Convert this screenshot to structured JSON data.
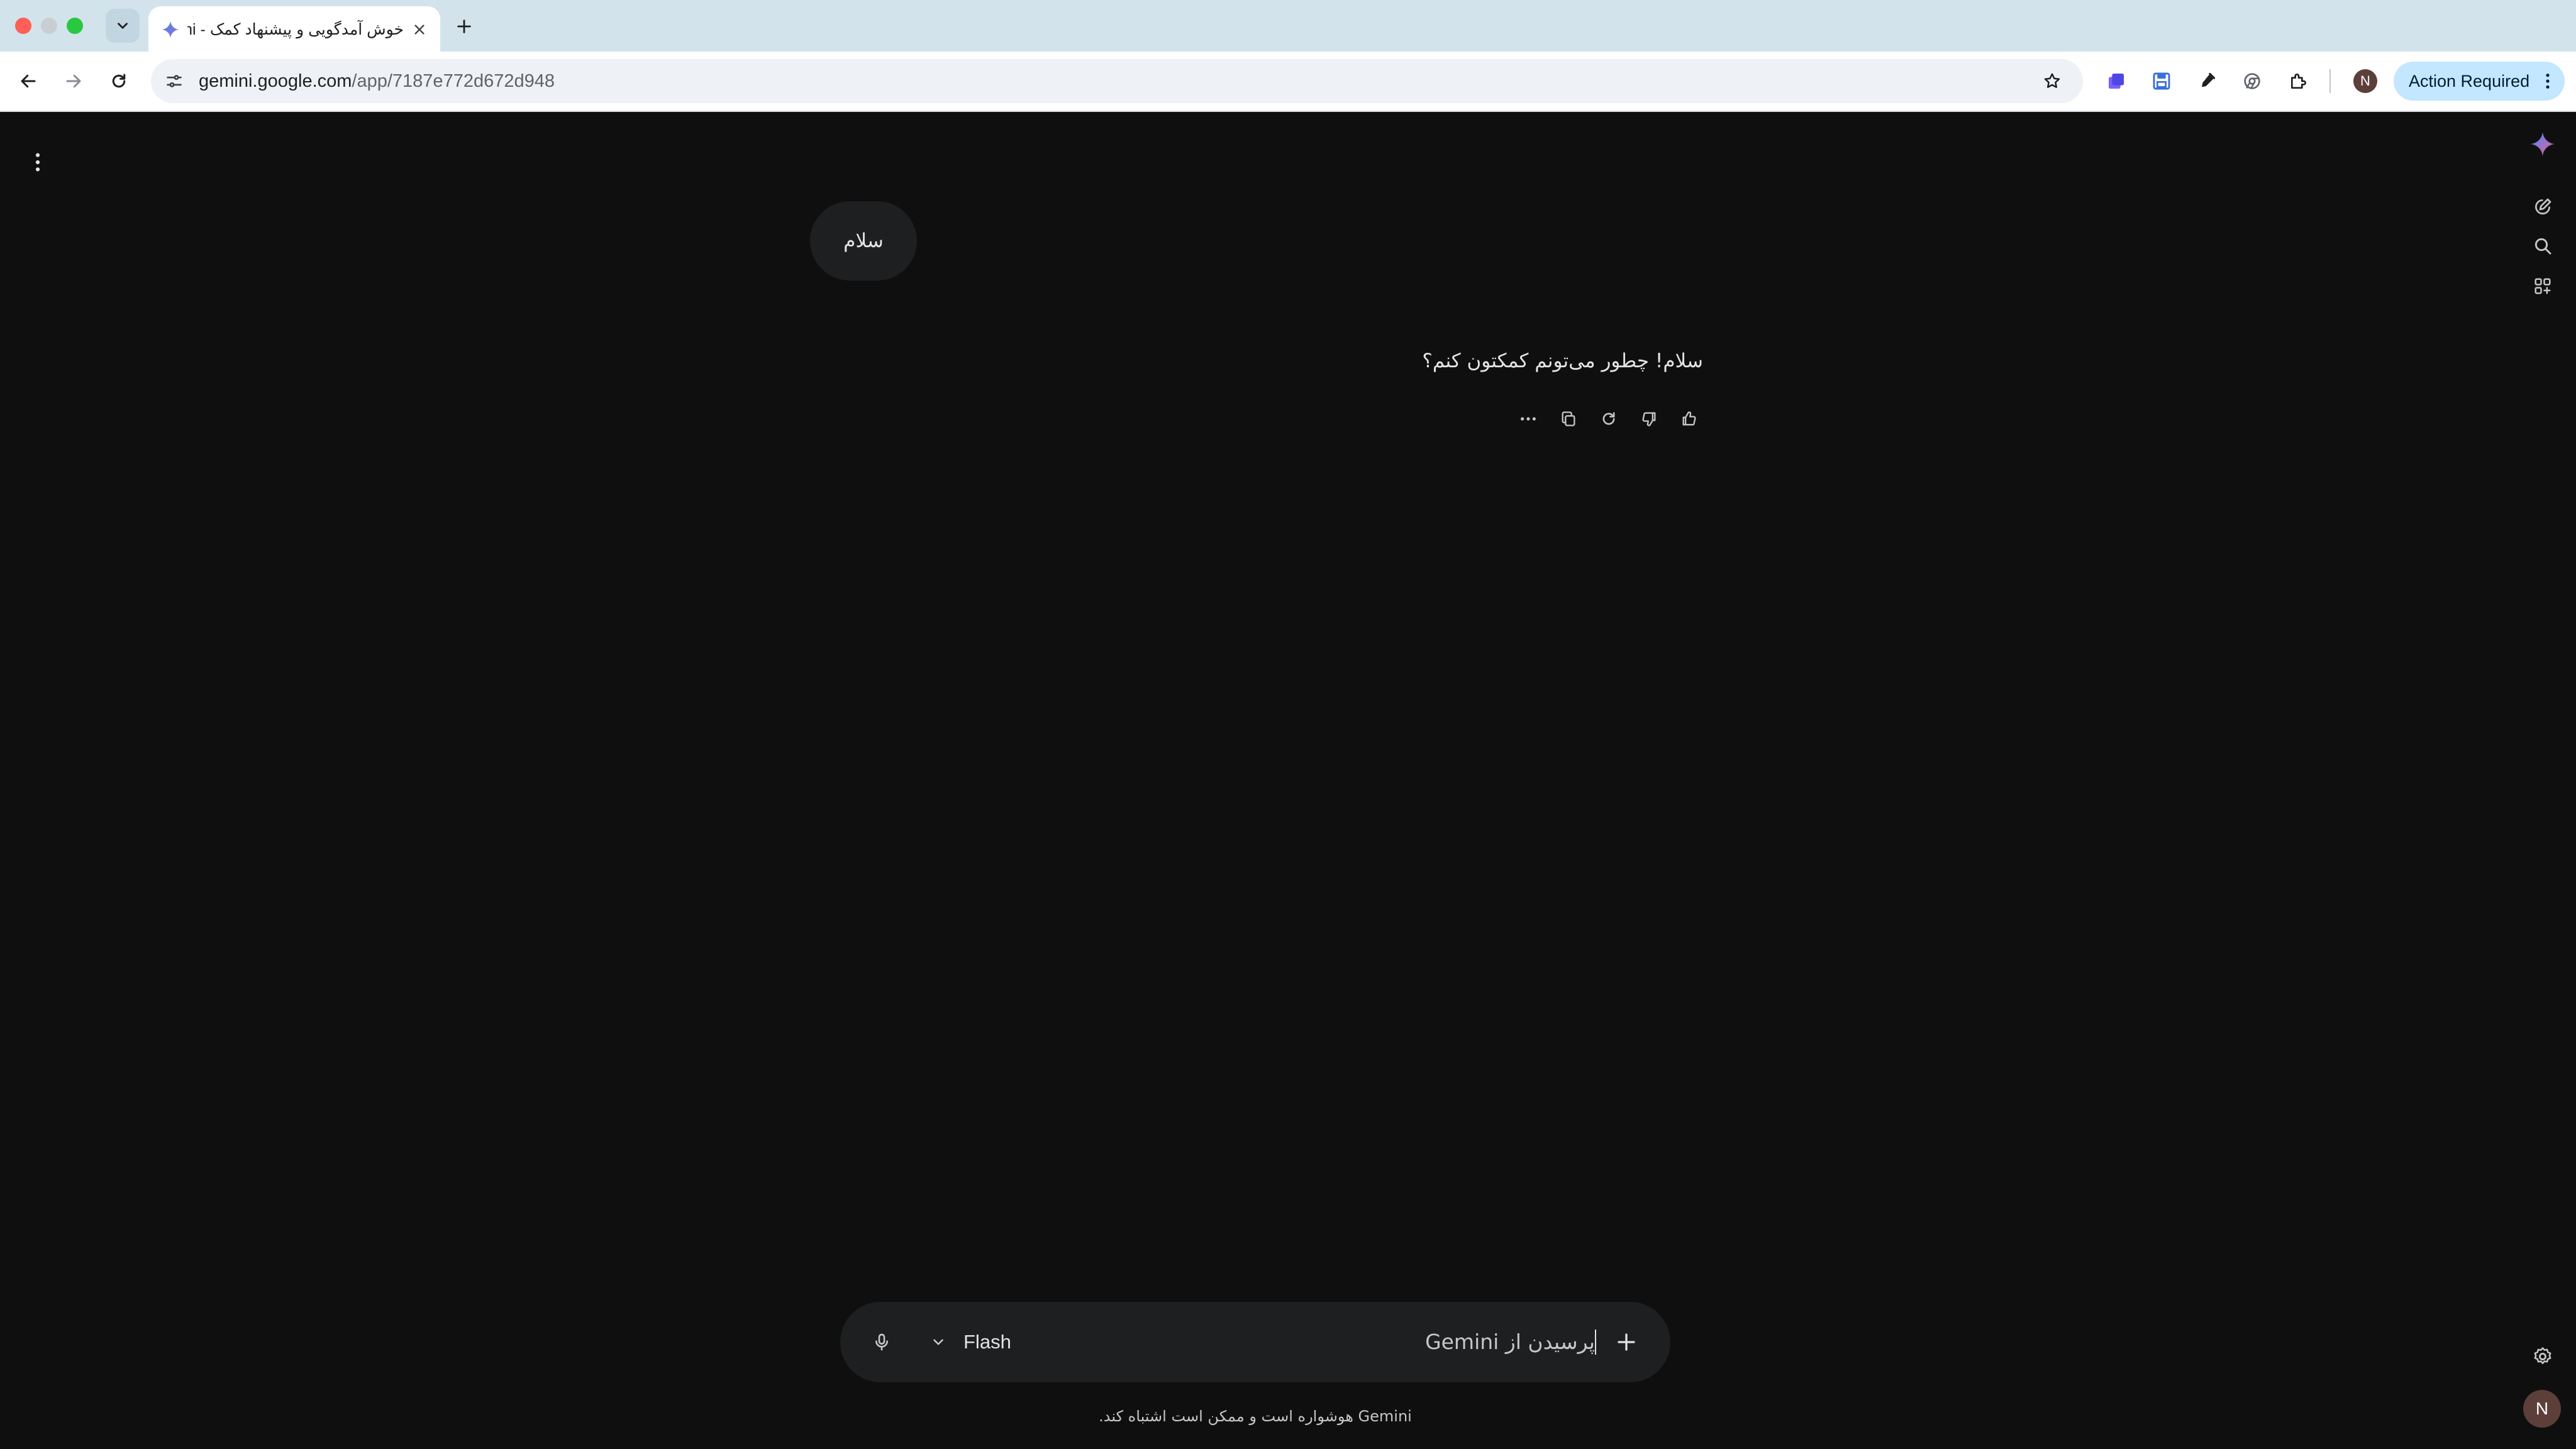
{
  "browser": {
    "tab_title": "خوش آمدگویی و پیشنهاد کمک - Gemini",
    "url_host": "gemini.google.com",
    "url_path": "/app/7187e772d672d948",
    "profile_initial": "N",
    "action_required_label": "Action Required"
  },
  "conversation": {
    "user_message": "سلام",
    "model_response": "سلام! چطور می‌تونم کمکتون کنم؟"
  },
  "composer": {
    "model_label": "Flash",
    "placeholder": "پرسیدن از Gemini"
  },
  "footer": {
    "disclaimer": "Gemini هوشواره است و ممکن است اشتباه کند."
  },
  "account": {
    "initial": "N"
  },
  "colors": {
    "page_background": "#0f0f0f",
    "surface": "#1e1f20",
    "text_primary": "#e3e3e3",
    "action_required_bg": "#c2e7ff"
  },
  "icons": [
    "chevron-down-icon",
    "gemini-favicon-icon",
    "close-icon",
    "plus-icon",
    "back-arrow-icon",
    "forward-arrow-icon",
    "reload-icon",
    "site-info-icon",
    "star-icon",
    "extension-icon",
    "save-icon",
    "pen-icon",
    "chrome-lab-icon",
    "puzzle-icon",
    "more-vert-icon",
    "gemini-logo-icon",
    "new-chat-icon",
    "search-icon",
    "apps-icon",
    "copy-icon",
    "regenerate-icon",
    "thumb-down-icon",
    "thumb-up-icon",
    "more-horiz-icon",
    "mic-icon",
    "settings-icon"
  ]
}
